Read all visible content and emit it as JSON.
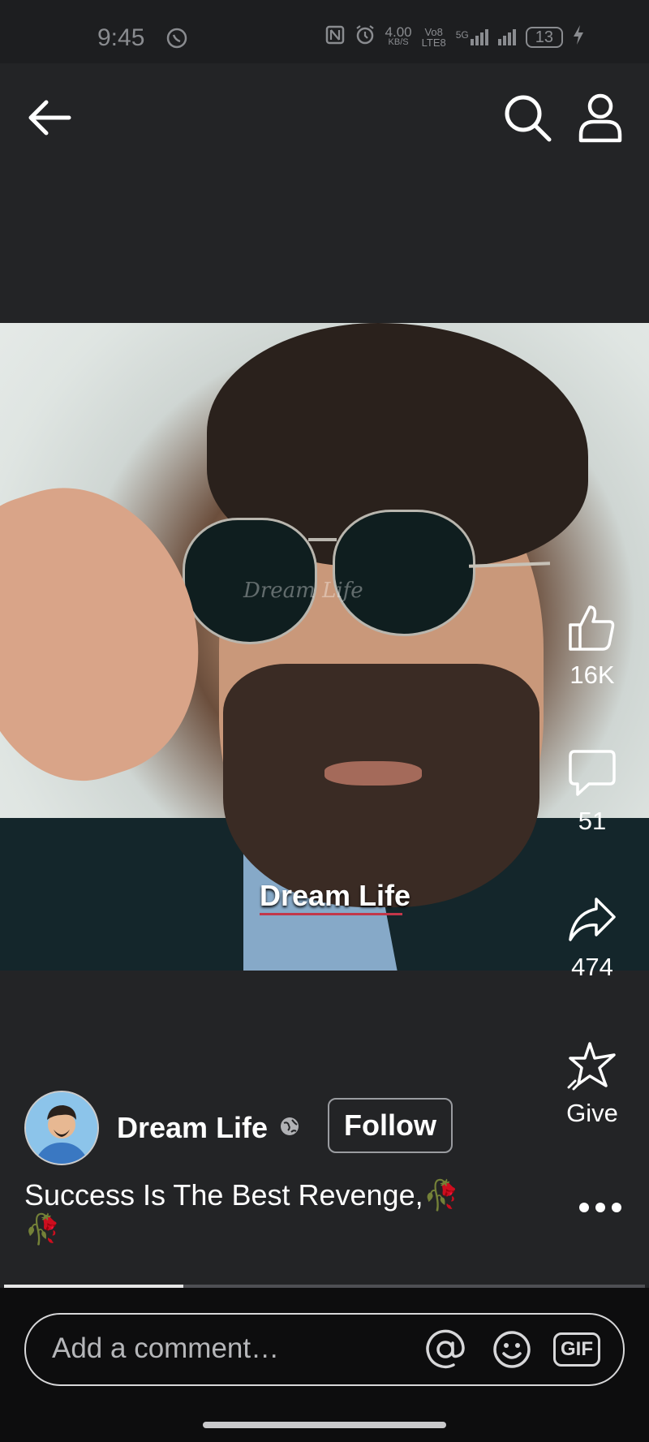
{
  "status_bar": {
    "time": "9:45",
    "speed": "4.00",
    "speed_unit": "KB/S",
    "volte_top": "Vo8",
    "volte_bottom": "LTE8",
    "network": "5G",
    "battery": "13"
  },
  "video": {
    "watermark": "Dream Life",
    "caption": "Dream Life",
    "progress_percent": 28
  },
  "actions": {
    "likes": "16K",
    "comments": "51",
    "shares": "474",
    "give": "Give"
  },
  "author": {
    "name": "Dream Life",
    "follow_label": "Follow"
  },
  "post": {
    "description": "Success Is The Best Revenge,🥀🥀"
  },
  "comment_bar": {
    "placeholder": "Add a comment…",
    "gif_label": "GIF"
  },
  "colors": {
    "background": "#232426",
    "bottom_bar": "#0d0d0e",
    "caption_underline": "#c2374a"
  }
}
